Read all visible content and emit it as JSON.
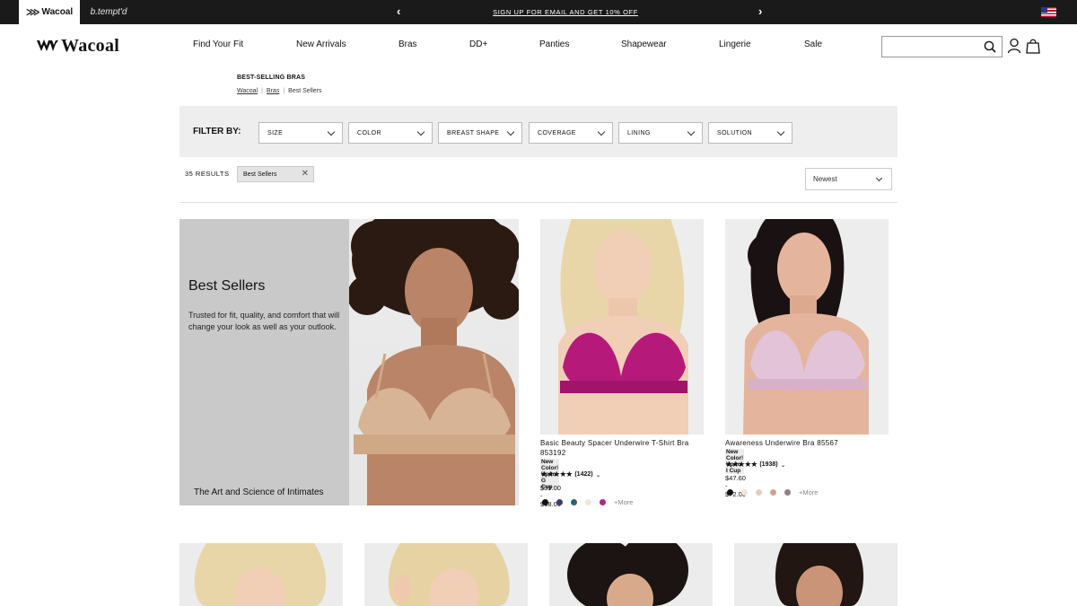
{
  "topbar": {
    "brand_tabs": [
      {
        "label": "Wacoal"
      },
      {
        "label": "b.tempt'd"
      }
    ],
    "promo_text": "SIGN UP FOR EMAIL AND GET 10% OFF",
    "locale_flag": "us-flag-icon"
  },
  "header": {
    "logo_text": "Wacoal",
    "nav": [
      {
        "label": "Find Your Fit"
      },
      {
        "label": "New Arrivals"
      },
      {
        "label": "Bras"
      },
      {
        "label": "DD+"
      },
      {
        "label": "Panties"
      },
      {
        "label": "Shapewear"
      },
      {
        "label": "Lingerie"
      },
      {
        "label": "Sale"
      }
    ],
    "search": {
      "value": "",
      "placeholder": ""
    },
    "icons": [
      "search-icon",
      "account-icon",
      "bag-icon"
    ]
  },
  "breadcrumb": {
    "category_title": "BEST-SELLING BRAS",
    "items": [
      "Wacoal",
      "Bras",
      "Best Sellers"
    ]
  },
  "filters": {
    "label": "FILTER BY:",
    "dropdowns": [
      {
        "label": "SIZE"
      },
      {
        "label": "COLOR"
      },
      {
        "label": "BREAST SHAPE"
      },
      {
        "label": "COVERAGE"
      },
      {
        "label": "LINING"
      },
      {
        "label": "SOLUTION"
      }
    ]
  },
  "results": {
    "count_label": "35 RESULTS",
    "active_chip": "Best Sellers",
    "sort_value": "Newest"
  },
  "hero": {
    "title": "Best Sellers",
    "description": "Trusted for fit, quality, and comfort that will change your look as well as your outlook.",
    "footer": "The Art and Science of Intimates"
  },
  "products": [
    {
      "name": "Basic Beauty Spacer Underwire T-Shirt Bra 853192",
      "badge": "New Color! Up to G Cup",
      "stars": "★★★★★",
      "rating": 4.5,
      "reviews": "(1422)",
      "price": "$39.00 - $68.00",
      "swatches": [
        "#111111",
        "#3b3f6e",
        "#2f5f6a",
        "#f1e6d8",
        "#b0277e"
      ],
      "more": "+More",
      "image_colors": {
        "garment": "#b51a7a",
        "skin": "#f0cfb6",
        "hair": "#e8d6a8"
      }
    },
    {
      "name": "Awareness Underwire Bra 85567",
      "badge": "New Color! Up to I Cup",
      "stars": "★★★★★",
      "rating": 4.5,
      "reviews": "(1938)",
      "price": "$47.60 - $72.00",
      "swatches": [
        "#111111",
        "#f0e4da",
        "#e7cdb8",
        "#c9a495",
        "#8e8088"
      ],
      "more": "+More",
      "image_colors": {
        "garment": "#e3c3d8",
        "skin": "#e4b59c",
        "hair": "#1a1212"
      }
    }
  ],
  "colors": {
    "topbar_bg": "#1a1a1a",
    "filter_bg": "#eeeeee",
    "hero_bg": "#c9c9c9",
    "card_bg": "#ececec"
  }
}
